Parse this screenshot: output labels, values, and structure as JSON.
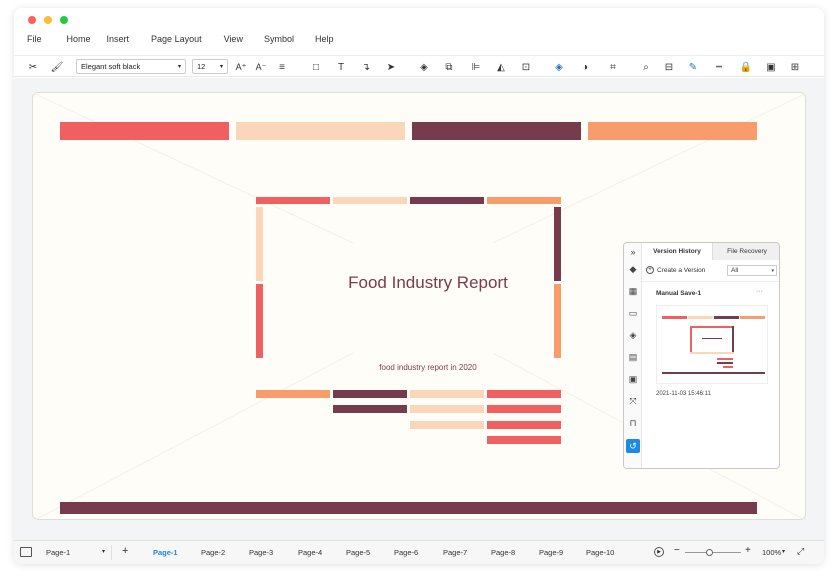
{
  "menu": [
    "File",
    "Home",
    "Insert",
    "Page Layout",
    "View",
    "Symbol",
    "Help"
  ],
  "toolbar": {
    "font_name": "Elegant soft black",
    "font_size": "12"
  },
  "colors": {
    "coral": "#f06060",
    "peach": "#fcd6b8",
    "maroon": "#763b4c",
    "orange": "#f99c6c",
    "accent": "#1e88e5"
  },
  "slide": {
    "title": "Food Industry Report",
    "subtitle": "food industry report in 2020"
  },
  "panel": {
    "tab_active": "Version History",
    "tab_other": "File Recovery",
    "create_label": "Create a Version",
    "filter": "All",
    "save_name": "Manual Save-1",
    "more": "···",
    "timestamp": "2021-11-03 15:46:11"
  },
  "status": {
    "page_select": "Page-1",
    "add": "+",
    "pages": [
      "Page-1",
      "Page-2",
      "Page-3",
      "Page-4",
      "Page-5",
      "Page-6",
      "Page-7",
      "Page-8",
      "Page-9",
      "Page-10"
    ],
    "active_page": "Page-1",
    "zoom_minus": "−",
    "zoom_plus": "+",
    "zoom": "100%",
    "zoom_level": 0.43
  }
}
